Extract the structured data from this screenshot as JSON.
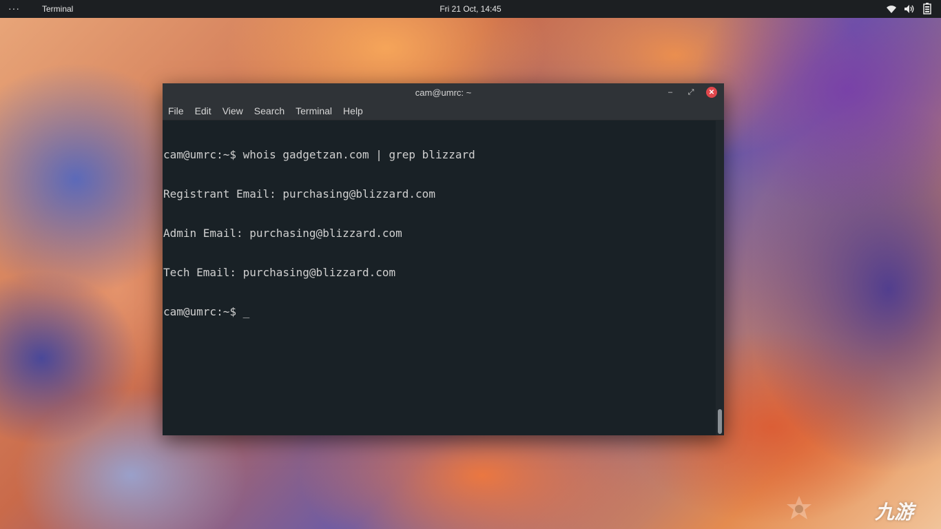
{
  "topbar": {
    "activities_label": "···",
    "app_name": "Terminal",
    "clock": "Fri 21 Oct, 14:45",
    "tray_icons": [
      "wifi-icon",
      "volume-icon",
      "battery-icon"
    ]
  },
  "window": {
    "title": "cam@umrc: ~",
    "menu": [
      "File",
      "Edit",
      "View",
      "Search",
      "Terminal",
      "Help"
    ],
    "buttons": {
      "minimize": "–",
      "maximize": "⤢",
      "close": "✕"
    }
  },
  "terminal": {
    "lines": [
      "cam@umrc:~$ whois gadgetzan.com | grep blizzard",
      "Registrant Email: purchasing@blizzard.com",
      "Admin Email: purchasing@blizzard.com",
      "Tech Email: purchasing@blizzard.com",
      "cam@umrc:~$ _"
    ]
  },
  "watermark": {
    "logo_text": "九游"
  },
  "colors": {
    "topbar_bg": "#1c1f22",
    "titlebar_bg": "#2f3337",
    "terminal_bg": "#192126",
    "terminal_fg": "#d0d0d0",
    "close_button": "#e0474c"
  }
}
